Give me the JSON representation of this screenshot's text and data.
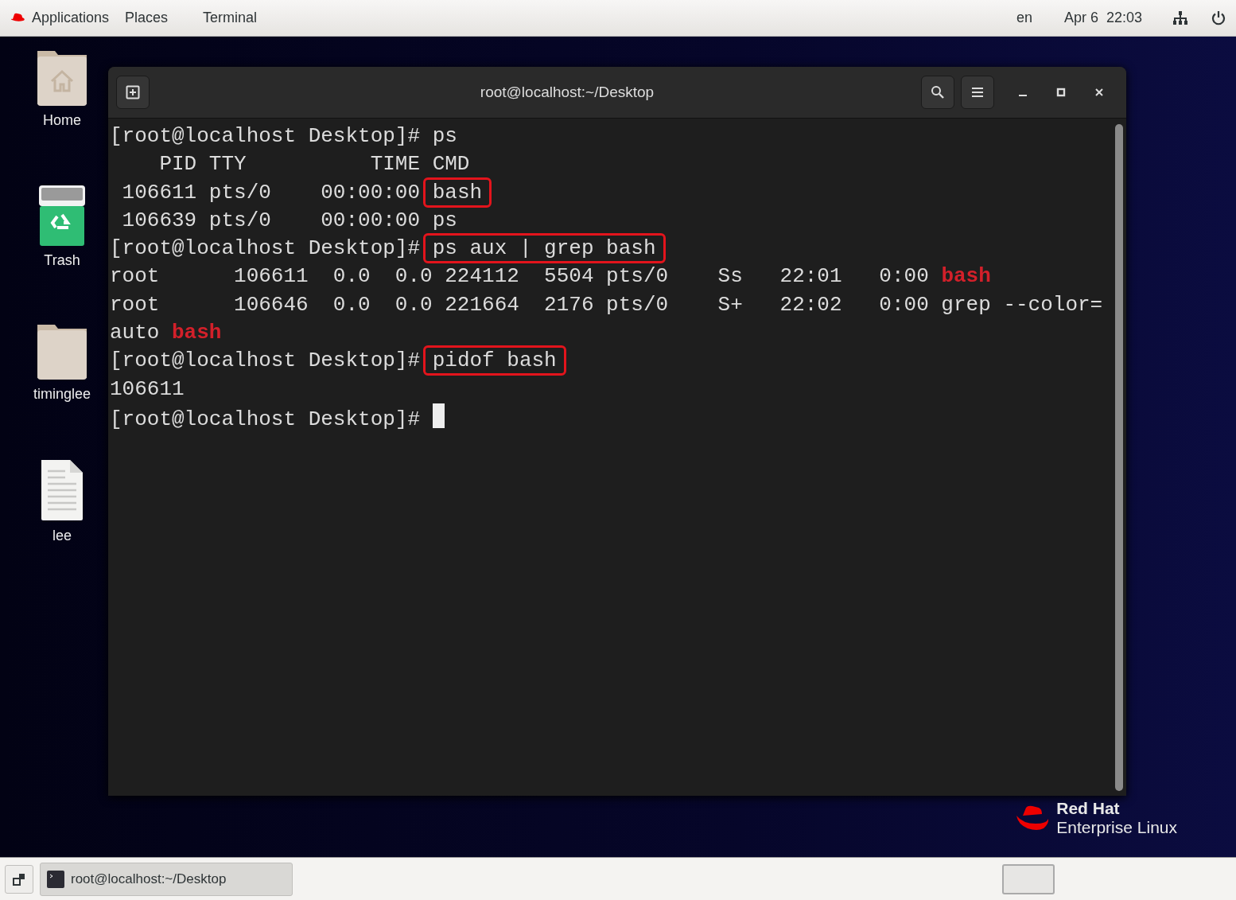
{
  "top_bar": {
    "menus": [
      "Applications",
      "Places",
      "Terminal"
    ],
    "keyboard": "en",
    "clock": "Apr 6  22:03"
  },
  "desktop_icons": [
    {
      "label": "Home",
      "kind": "home"
    },
    {
      "label": "Trash",
      "kind": "trash"
    },
    {
      "label": "timinglee",
      "kind": "folder"
    },
    {
      "label": "lee",
      "kind": "file"
    }
  ],
  "terminal": {
    "title": "root@localhost:~/Desktop",
    "lines": [
      {
        "segments": [
          {
            "text": "[root@localhost Desktop]# ps",
            "kind": "plain"
          }
        ]
      },
      {
        "segments": [
          {
            "text": "    PID TTY          TIME CMD",
            "kind": "plain"
          }
        ]
      },
      {
        "segments": [
          {
            "text": " 106611 pts/0    00:00:00 ",
            "kind": "plain"
          },
          {
            "text": "bash",
            "kind": "boxed"
          }
        ]
      },
      {
        "segments": [
          {
            "text": " 106639 pts/0    00:00:00 ps",
            "kind": "plain"
          }
        ]
      },
      {
        "segments": [
          {
            "text": "[root@localhost Desktop]# ",
            "kind": "plain"
          },
          {
            "text": "ps aux | grep bash",
            "kind": "boxed"
          }
        ]
      },
      {
        "segments": [
          {
            "text": "root      106611  0.0  0.0 224112  5504 pts/0    Ss   22:01   0:00 ",
            "kind": "plain"
          },
          {
            "text": "bash",
            "kind": "match"
          }
        ]
      },
      {
        "segments": [
          {
            "text": "root      106646  0.0  0.0 221664  2176 pts/0    S+   22:02   0:00 grep --color=",
            "kind": "plain"
          }
        ]
      },
      {
        "segments": [
          {
            "text": "auto ",
            "kind": "plain"
          },
          {
            "text": "bash",
            "kind": "match"
          }
        ]
      },
      {
        "segments": [
          {
            "text": "[root@localhost Desktop]# ",
            "kind": "plain"
          },
          {
            "text": "pidof bash",
            "kind": "boxed"
          }
        ]
      },
      {
        "segments": [
          {
            "text": "106611",
            "kind": "plain"
          }
        ]
      },
      {
        "segments": [
          {
            "text": "[root@localhost Desktop]# ",
            "kind": "plain"
          }
        ],
        "cursor": true
      }
    ]
  },
  "branding": {
    "line_1": "Red Hat",
    "line_2": "Enterprise Linux"
  },
  "taskbar": {
    "tasks": [
      {
        "label": "root@localhost:~/Desktop",
        "selected": true
      }
    ]
  }
}
